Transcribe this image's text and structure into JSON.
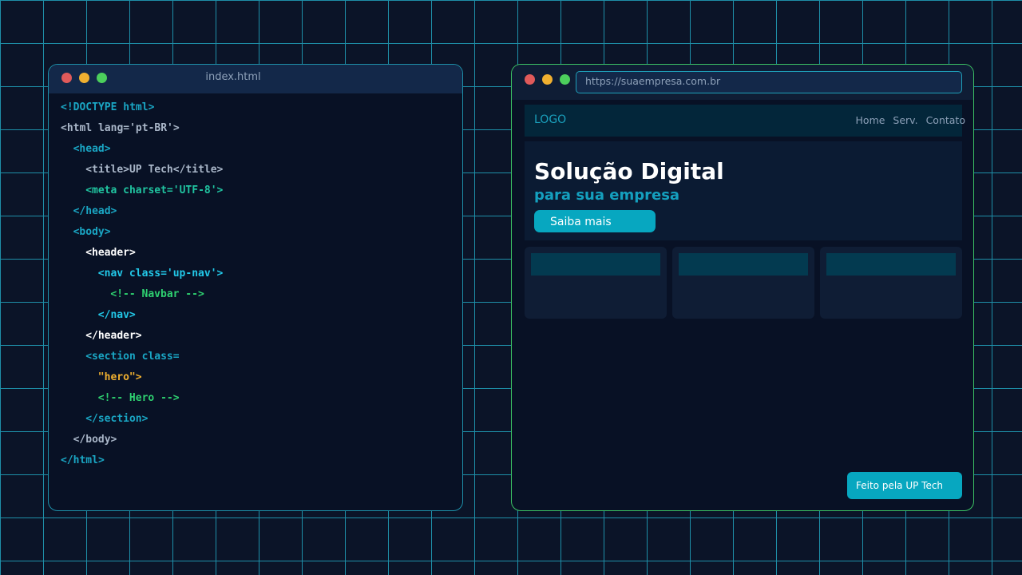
{
  "colors": {
    "background": "#0b1428",
    "grid_line": "#1e8fa8",
    "accent": "#07a7c0",
    "editor_border": "#1e8fa8",
    "browser_border": "#3cc264"
  },
  "editor": {
    "title": "index.html",
    "window_controls": [
      "close-dot",
      "minimize-dot",
      "maximize-dot"
    ],
    "code_lines": [
      {
        "indent": 0,
        "text": "<!DOCTYPE html>",
        "color": "#1aa6c4"
      },
      {
        "indent": 0,
        "text": "<html lang='pt-BR'>",
        "color": "#a9b6c8"
      },
      {
        "indent": 1,
        "text": "<head>",
        "color": "#1aa6c4"
      },
      {
        "indent": 2,
        "text": "<title>UP Tech</title>",
        "color": "#a9b6c8"
      },
      {
        "indent": 2,
        "text": "<meta charset='UTF-8'>",
        "color": "#20c4a0"
      },
      {
        "indent": 1,
        "text": "</head>",
        "color": "#1aa6c4"
      },
      {
        "indent": 1,
        "text": "<body>",
        "color": "#1aa6c4"
      },
      {
        "indent": 2,
        "text": "<header>",
        "color": "#ffffff"
      },
      {
        "indent": 3,
        "text": "<nav class='up-nav'>",
        "color": "#22c8e8"
      },
      {
        "indent": 4,
        "text": "<!-- Navbar -->",
        "color": "#2ed070"
      },
      {
        "indent": 3,
        "text": "</nav>",
        "color": "#22c8e8"
      },
      {
        "indent": 2,
        "text": "</header>",
        "color": "#ffffff"
      },
      {
        "indent": 2,
        "text": "<section class=",
        "color": "#1aa6c4"
      },
      {
        "indent": 3,
        "text": "\"hero\">",
        "color": "#f0b030"
      },
      {
        "indent": 3,
        "text": "<!-- Hero -->",
        "color": "#2ed070"
      },
      {
        "indent": 2,
        "text": "</section>",
        "color": "#1aa6c4"
      },
      {
        "indent": 1,
        "text": "</body>",
        "color": "#a9b6c8"
      },
      {
        "indent": 0,
        "text": "</html>",
        "color": "#1aa6c4"
      }
    ]
  },
  "browser": {
    "url": "https://suaempresa.com.br",
    "site": {
      "logo": "LOGO",
      "nav_links": [
        "Home",
        "Serv.",
        "Contato"
      ],
      "hero_title": "Solução Digital",
      "hero_subtitle": "para sua empresa",
      "hero_button": "Saiba mais",
      "card_count": 3
    },
    "footer_badge": "Feito pela UP Tech"
  }
}
